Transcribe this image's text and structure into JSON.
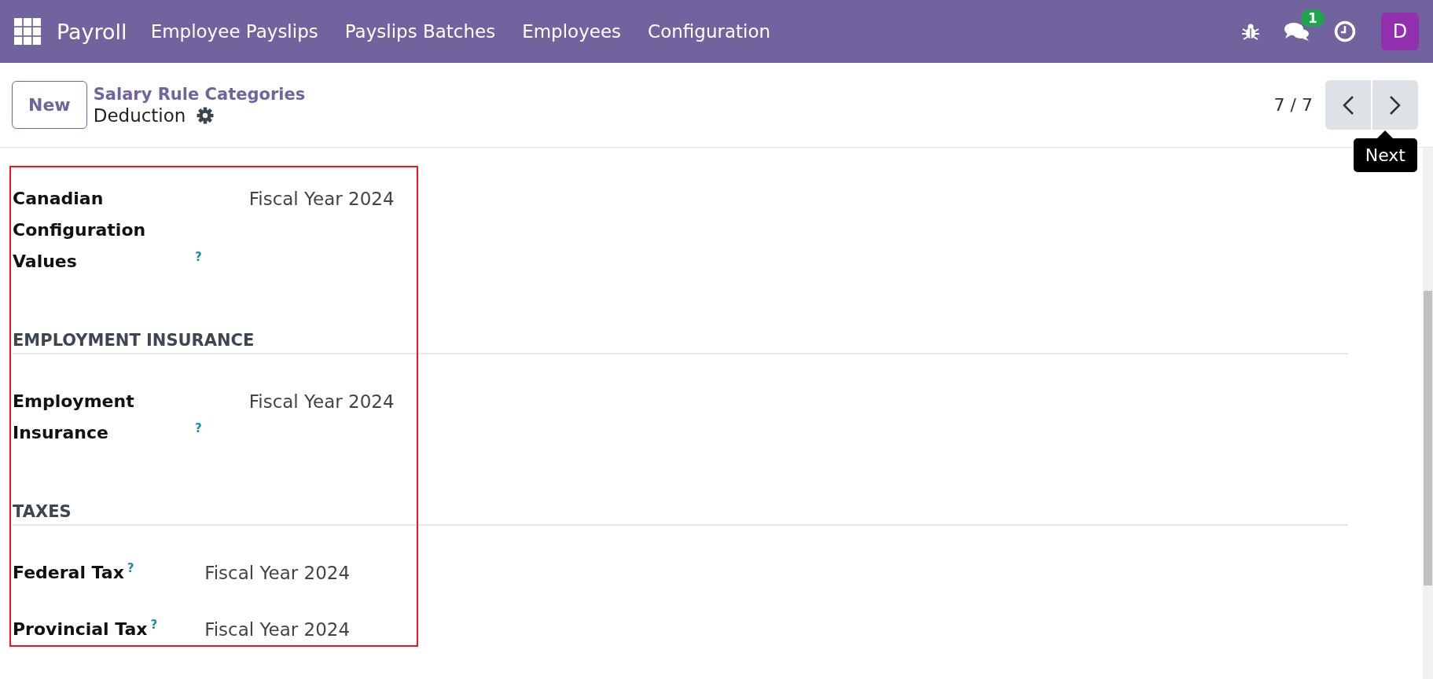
{
  "navbar": {
    "app": "Payroll",
    "menu": [
      "Employee Payslips",
      "Payslips Batches",
      "Employees",
      "Configuration"
    ],
    "chat_badge": "1",
    "avatar": "D"
  },
  "control_panel": {
    "new_button": "New",
    "breadcrumb": "Salary Rule Categories",
    "record": "Deduction",
    "pager": "7 / 7",
    "tooltip": "Next"
  },
  "sections": [
    {
      "fields": [
        {
          "label": "Canadian Configuration Values",
          "help": "?",
          "value": "Fiscal Year 2024"
        }
      ]
    },
    {
      "title": "EMPLOYMENT INSURANCE",
      "fields": [
        {
          "label": "Employment Insurance",
          "help": "?",
          "value": "Fiscal Year 2024"
        }
      ]
    },
    {
      "title": "TAXES",
      "fields": [
        {
          "label": "Federal Tax",
          "help": "?",
          "value": "Fiscal Year 2024"
        },
        {
          "label": "Provincial Tax",
          "help": "?",
          "value": "Fiscal Year 2024"
        }
      ]
    }
  ]
}
